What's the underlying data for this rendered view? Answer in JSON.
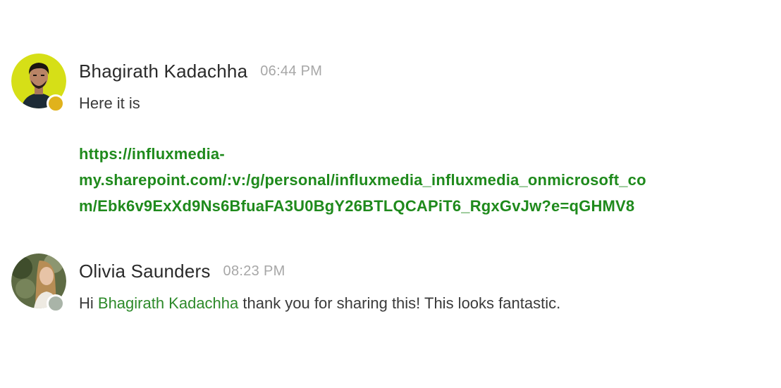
{
  "messages": [
    {
      "author": "Bhagirath Kadachha",
      "time": "06:44 PM",
      "text": "Here it is",
      "link_lines": [
        "https://influxmedia-",
        "my.sharepoint.com/:v:/g/personal/influxmedia_influxmedia_onmicrosoft_co",
        "m/Ebk6v9ExXd9Ns6BfuaFA3U0BgY26BTLQCAPiT6_RgxGvJw?e=qGHMV8"
      ],
      "presence_color": "#e0b21c",
      "avatar_ring_color": "#d9e21a"
    },
    {
      "author": "Olivia Saunders",
      "time": "08:23 PM",
      "text_prefix": "Hi ",
      "mention": "Bhagirath Kadachha",
      "text_suffix": " thank you for sharing this! This looks fantastic.",
      "presence_color": "#a9b4a8"
    }
  ],
  "colors": {
    "link": "#1f8a1c",
    "mention": "#2d8a2a",
    "timestamp": "#a7a7a7"
  }
}
